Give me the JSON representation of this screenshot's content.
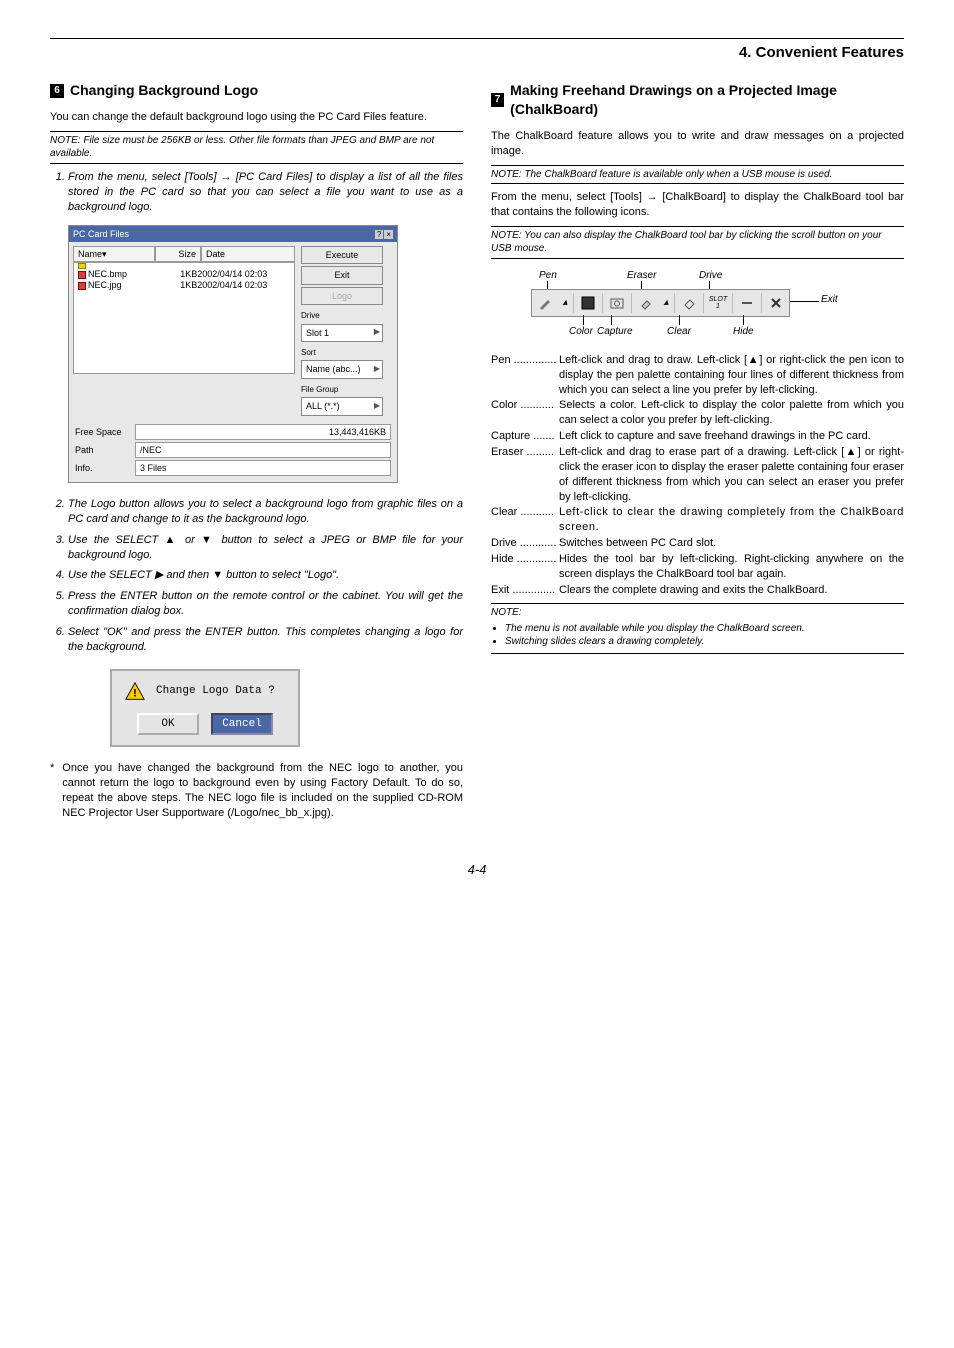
{
  "chapter": "4. Convenient Features",
  "pageNum": "4-4",
  "left": {
    "num": "6",
    "title": "Changing Background Logo",
    "intro": "You can change the default background logo using the PC Card Files feature.",
    "note1": "NOTE: File size must be 256KB or less. Other file formats than JPEG and BMP are not available.",
    "steps": [
      "From the menu, select [Tools] → [PC Card Files] to display a list of all the files stored in the PC card so that you can select a file you want to use as a background logo.",
      "The Logo button allows you to select a background logo from graphic files on a PC card and change to it as the background logo.",
      "Use the SELECT ▲ or ▼ button to select a JPEG or BMP file for your background logo.",
      "Use the SELECT ▶ and then ▼ button to select \"Logo\".",
      "Press the ENTER button on the remote control or the cabinet. You will get the confirmation dialog box.",
      "Select \"OK\" and press the ENTER button. This completes changing a logo for the background."
    ],
    "ast": "Once you have changed the background from the NEC logo to another, you cannot return the logo to background even by using Factory Default. To do so, repeat the above steps. The NEC logo file is included on the supplied CD-ROM NEC Projector User Supportware (/Logo/nec_bb_x.jpg).",
    "pcfiles": {
      "title": "PC Card Files",
      "cols": {
        "name": "Name▾",
        "size": "Size",
        "date": "Date"
      },
      "files": [
        {
          "n": "NEC.bmp",
          "s": "1KB",
          "d": "2002/04/14 02:03"
        },
        {
          "n": "NEC.jpg",
          "s": "1KB",
          "d": "2002/04/14 02:03"
        }
      ],
      "buttons": {
        "execute": "Execute",
        "exit": "Exit",
        "logo": "Logo"
      },
      "driveLbl": "Drive",
      "driveVal": "Slot 1",
      "sortLbl": "Sort",
      "sortVal": "Name (abc...)",
      "fgLbl": "File Group",
      "fgVal": "ALL (*.*)",
      "freeLbl": "Free Space",
      "freeVal": "13,443,416KB",
      "pathLbl": "Path",
      "pathVal": "/NEC",
      "infoLbl": "Info.",
      "infoVal": "3 Files"
    },
    "dialog": {
      "msg": "Change Logo Data ?",
      "ok": "OK",
      "cancel": "Cancel"
    }
  },
  "right": {
    "num": "7",
    "title": "Making Freehand Drawings on a Projected Image (ChalkBoard)",
    "intro": "The ChalkBoard feature allows you to write and draw messages on a projected image.",
    "note1": "NOTE: The ChalkBoard feature is available only when a USB mouse is used.",
    "mid": "From the menu, select [Tools] → [ChalkBoard] to display the ChalkBoard tool bar that contains the following icons.",
    "note2": "NOTE: You can also display the ChalkBoard tool bar by clicking the scroll button on your USB mouse.",
    "toolbar": {
      "topLabels": {
        "pen": "Pen",
        "eraser": "Eraser",
        "drive": "Drive",
        "exit": "Exit"
      },
      "botLabels": {
        "color": "Color",
        "capture": "Capture",
        "clear": "Clear",
        "hide": "Hide"
      },
      "slot": "SLOT 1"
    },
    "defs": [
      {
        "t": "Pen ..............",
        "d": "Left-click and drag to draw. Left-click [▲] or right-click the pen icon to display the pen palette containing four lines of different thickness from which you can select a line you prefer by left-clicking."
      },
      {
        "t": "Color ...........",
        "d": "Selects a color. Left-click to display the color palette from which you can select a color you prefer by left-clicking."
      },
      {
        "t": "Capture .......",
        "d": "Left click to capture and save freehand drawings in the PC card."
      },
      {
        "t": "Eraser .........",
        "d": "Left-click and drag to erase part of a drawing. Left-click [▲] or right-click the eraser icon to display the eraser palette containing four eraser of different thickness from which you can select an eraser you prefer by left-clicking."
      },
      {
        "t": "Clear ...........",
        "d": "Left-click to clear the drawing completely from the ChalkBoard screen."
      },
      {
        "t": "Drive ............",
        "d": "Switches between PC Card slot."
      },
      {
        "t": "Hide .............",
        "d": "Hides the tool bar by left-clicking. Right-clicking anywhere on the screen displays the ChalkBoard tool bar again."
      },
      {
        "t": "Exit ..............",
        "d": "Clears the complete drawing and exits the ChalkBoard."
      }
    ],
    "noteList": {
      "head": "NOTE:",
      "items": [
        "The menu is not available while you display the ChalkBoard screen.",
        "Switching slides clears a drawing completely."
      ]
    }
  }
}
